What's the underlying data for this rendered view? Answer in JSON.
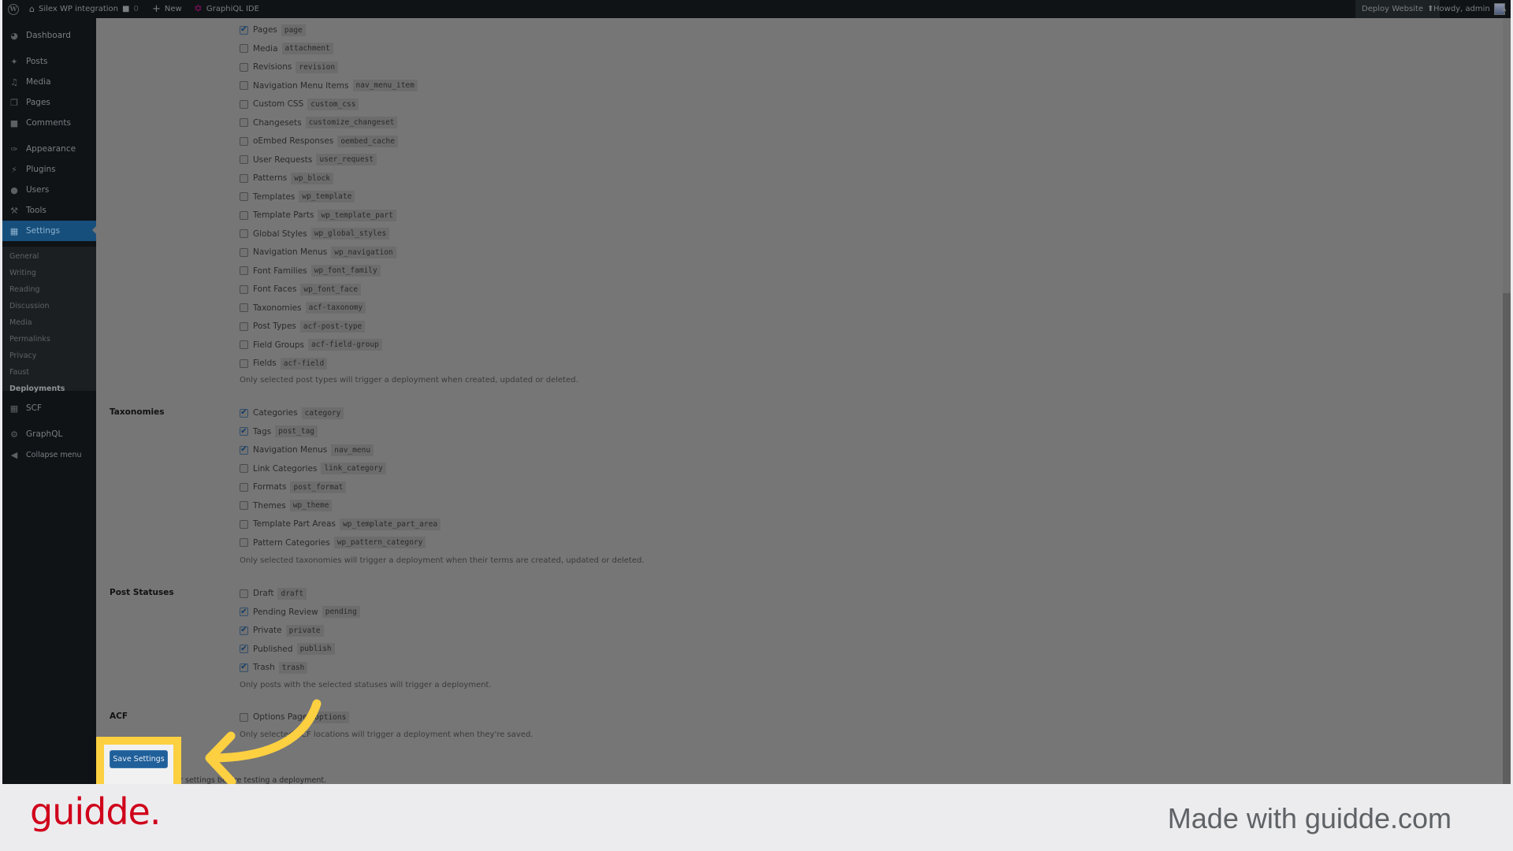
{
  "adminbar": {
    "site_name": "Silex WP integration",
    "comments_count": "0",
    "new_label": "New",
    "graphiql_label": "GraphiQL IDE",
    "deploy_label": "Deploy Website",
    "howdy_label": "Howdy, admin"
  },
  "sidebar": {
    "items": [
      {
        "label": "Dashboard",
        "icon": "dashboard-icon"
      },
      {
        "label": "Posts",
        "icon": "pin-icon"
      },
      {
        "label": "Media",
        "icon": "media-icon"
      },
      {
        "label": "Pages",
        "icon": "pages-icon"
      },
      {
        "label": "Comments",
        "icon": "comment-icon"
      },
      {
        "label": "Appearance",
        "icon": "brush-icon"
      },
      {
        "label": "Plugins",
        "icon": "plug-icon"
      },
      {
        "label": "Users",
        "icon": "user-icon"
      },
      {
        "label": "Tools",
        "icon": "wrench-icon"
      },
      {
        "label": "Settings",
        "icon": "settings-icon"
      },
      {
        "label": "SCF",
        "icon": "grid-icon"
      },
      {
        "label": "GraphQL",
        "icon": "graphql-icon"
      },
      {
        "label": "Collapse menu",
        "icon": "collapse-icon"
      }
    ],
    "settings_submenu": [
      "General",
      "Writing",
      "Reading",
      "Discussion",
      "Media",
      "Permalinks",
      "Privacy",
      "Faust",
      "Deployments"
    ],
    "current_submenu": "Deployments"
  },
  "post_types": {
    "items": [
      {
        "label": "Pages",
        "slug": "page",
        "checked": true
      },
      {
        "label": "Media",
        "slug": "attachment",
        "checked": false
      },
      {
        "label": "Revisions",
        "slug": "revision",
        "checked": false
      },
      {
        "label": "Navigation Menu Items",
        "slug": "nav_menu_item",
        "checked": false
      },
      {
        "label": "Custom CSS",
        "slug": "custom_css",
        "checked": false
      },
      {
        "label": "Changesets",
        "slug": "customize_changeset",
        "checked": false
      },
      {
        "label": "oEmbed Responses",
        "slug": "oembed_cache",
        "checked": false
      },
      {
        "label": "User Requests",
        "slug": "user_request",
        "checked": false
      },
      {
        "label": "Patterns",
        "slug": "wp_block",
        "checked": false
      },
      {
        "label": "Templates",
        "slug": "wp_template",
        "checked": false
      },
      {
        "label": "Template Parts",
        "slug": "wp_template_part",
        "checked": false
      },
      {
        "label": "Global Styles",
        "slug": "wp_global_styles",
        "checked": false
      },
      {
        "label": "Navigation Menus",
        "slug": "wp_navigation",
        "checked": false
      },
      {
        "label": "Font Families",
        "slug": "wp_font_family",
        "checked": false
      },
      {
        "label": "Font Faces",
        "slug": "wp_font_face",
        "checked": false
      },
      {
        "label": "Taxonomies",
        "slug": "acf-taxonomy",
        "checked": false
      },
      {
        "label": "Post Types",
        "slug": "acf-post-type",
        "checked": false
      },
      {
        "label": "Field Groups",
        "slug": "acf-field-group",
        "checked": false
      },
      {
        "label": "Fields",
        "slug": "acf-field",
        "checked": false
      }
    ],
    "hint": "Only selected post types will trigger a deployment when created, updated or deleted."
  },
  "taxonomies": {
    "heading": "Taxonomies",
    "items": [
      {
        "label": "Categories",
        "slug": "category",
        "checked": true
      },
      {
        "label": "Tags",
        "slug": "post_tag",
        "checked": true
      },
      {
        "label": "Navigation Menus",
        "slug": "nav_menu",
        "checked": true
      },
      {
        "label": "Link Categories",
        "slug": "link_category",
        "checked": false
      },
      {
        "label": "Formats",
        "slug": "post_format",
        "checked": false
      },
      {
        "label": "Themes",
        "slug": "wp_theme",
        "checked": false
      },
      {
        "label": "Template Part Areas",
        "slug": "wp_template_part_area",
        "checked": false
      },
      {
        "label": "Pattern Categories",
        "slug": "wp_pattern_category",
        "checked": false
      }
    ],
    "hint": "Only selected taxonomies will trigger a deployment when their terms are created, updated or deleted."
  },
  "post_statuses": {
    "heading": "Post Statuses",
    "items": [
      {
        "label": "Draft",
        "slug": "draft",
        "checked": false
      },
      {
        "label": "Pending Review",
        "slug": "pending",
        "checked": true
      },
      {
        "label": "Private",
        "slug": "private",
        "checked": true
      },
      {
        "label": "Published",
        "slug": "publish",
        "checked": true
      },
      {
        "label": "Trash",
        "slug": "trash",
        "checked": true
      }
    ],
    "hint": "Only posts with the selected statuses will trigger a deployment."
  },
  "acf": {
    "heading": "ACF",
    "items": [
      {
        "label": "Options Page",
        "slug": "options",
        "checked": false
      }
    ],
    "hint": "Only selected ACF locations will trigger a deployment when they're saved."
  },
  "save_button_label": "Save Settings",
  "save_note": "You must save your settings before testing a deployment.",
  "banner": {
    "brand": "guidde.",
    "made_with": "Made with guidde.com"
  },
  "colors": {
    "highlight": "#fdd041",
    "brand": "#d0021b",
    "primary_button": "#1f5f9a"
  }
}
